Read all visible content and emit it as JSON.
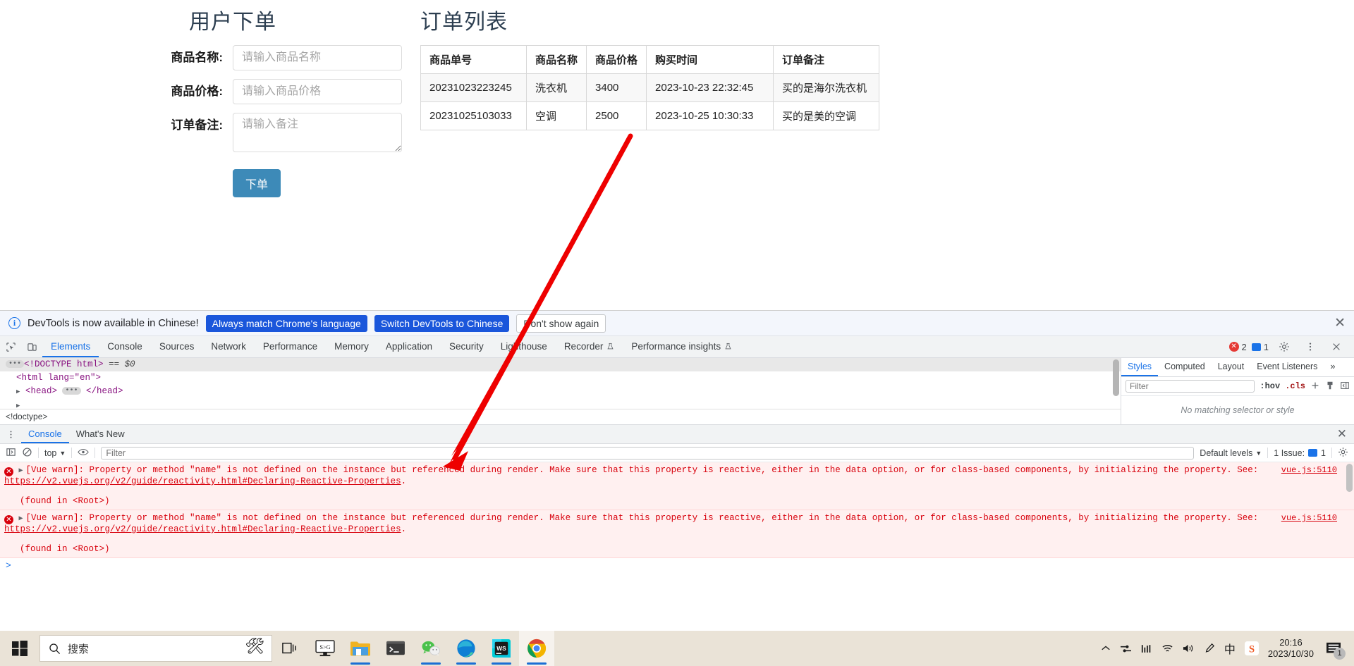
{
  "page": {
    "form": {
      "title": "用户下单",
      "fields": [
        {
          "label": "商品名称:",
          "placeholder": "请输入商品名称",
          "value": "",
          "type": "text"
        },
        {
          "label": "商品价格:",
          "placeholder": "请输入商品价格",
          "value": "",
          "type": "text"
        },
        {
          "label": "订单备注:",
          "placeholder": "请输入备注",
          "value": "",
          "type": "textarea"
        }
      ],
      "submit_label": "下单"
    },
    "order_list": {
      "title": "订单列表",
      "columns": [
        "商品单号",
        "商品名称",
        "商品价格",
        "购买时间",
        "订单备注"
      ],
      "rows": [
        [
          "20231023223245",
          "洗衣机",
          "3400",
          "2023-10-23 22:32:45",
          "买的是海尔洗衣机"
        ],
        [
          "20231025103033",
          "空调",
          "2500",
          "2023-10-25 10:30:33",
          "买的是美的空调"
        ]
      ]
    },
    "annotation": {
      "color": "#ee0000",
      "shape": "arrow"
    }
  },
  "devtools": {
    "banner": {
      "icon": "info-icon",
      "message": "DevTools is now available in Chinese!",
      "primary_button": "Always match Chrome's language",
      "secondary_button": "Switch DevTools to Chinese",
      "dismiss_button": "Don't show again",
      "close_icon": "✕",
      "accent": "#1a56db"
    },
    "tabs": [
      {
        "label": "Elements",
        "active": true
      },
      {
        "label": "Console",
        "active": false
      },
      {
        "label": "Sources",
        "active": false
      },
      {
        "label": "Network",
        "active": false
      },
      {
        "label": "Performance",
        "active": false
      },
      {
        "label": "Memory",
        "active": false
      },
      {
        "label": "Application",
        "active": false
      },
      {
        "label": "Security",
        "active": false
      },
      {
        "label": "Lighthouse",
        "active": false
      },
      {
        "label": "Recorder",
        "active": false,
        "badge": "experiment-flask-icon"
      },
      {
        "label": "Performance insights",
        "active": false,
        "badge": "experiment-flask-icon"
      }
    ],
    "status": {
      "error_count": "2",
      "message_count": "1"
    },
    "dom": {
      "line1_prefix": "<!DOCTYPE html>",
      "line1_suffix": "== $0",
      "line2": "<html lang=\"en\">",
      "line3_open": "<head>",
      "line3_close": "</head>",
      "breadcrumb": "<!doctype>"
    },
    "styles": {
      "tabs": [
        "Styles",
        "Computed",
        "Layout",
        "Event Listeners"
      ],
      "overflow": "»",
      "filter_placeholder": "Filter",
      "hov_label": ":hov",
      "cls_label": ".cls",
      "empty_message": "No matching selector or style"
    },
    "drawer": {
      "tabs": [
        {
          "label": "Console",
          "active": true
        },
        {
          "label": "What's New",
          "active": false
        }
      ],
      "close_icon": "✕",
      "context": "top",
      "filter_placeholder": "Filter",
      "levels": "Default levels",
      "issues_label": "1 Issue:",
      "issues_count": "1",
      "prompt": ">",
      "messages": [
        {
          "level": "error",
          "text": "[Vue warn]: Property or method \"name\" is not defined on the instance but referenced during render. Make sure that this property is reactive, either in the data option, or for class-based components, by initializing the property. See: ",
          "link": "https://v2.vuejs.org/v2/guide/reactivity.html#Declaring-Reactive-Properties",
          "tail": ".",
          "found_in": "(found in <Root>)",
          "source": "vue.js:5110"
        },
        {
          "level": "error",
          "text": "[Vue warn]: Property or method \"name\" is not defined on the instance but referenced during render. Make sure that this property is reactive, either in the data option, or for class-based components, by initializing the property. See: ",
          "link": "https://v2.vuejs.org/v2/guide/reactivity.html#Declaring-Reactive-Properties",
          "tail": ".",
          "found_in": "(found in <Root>)",
          "source": "vue.js:5110"
        }
      ]
    }
  },
  "taskbar": {
    "start_icon": "windows-logo-icon",
    "search_placeholder": "搜索",
    "search_icon": "search-icon",
    "apps": [
      {
        "name": "task-view-icon",
        "running": false
      },
      {
        "name": "snipaste-icon",
        "running": false
      },
      {
        "name": "file-explorer-icon",
        "running": true
      },
      {
        "name": "terminal-icon",
        "running": false
      },
      {
        "name": "wechat-icon",
        "running": true
      },
      {
        "name": "microsoft-edge-icon",
        "running": true
      },
      {
        "name": "webstorm-icon",
        "running": true
      },
      {
        "name": "google-chrome-icon",
        "running": true,
        "active": true
      }
    ],
    "tray": [
      "show-hidden-icons-icon",
      "network-adjust-icon",
      "equalizer-icon",
      "wifi-icon",
      "volume-icon",
      "pen-icon",
      "ime-chinese-icon",
      "sogou-input-icon"
    ],
    "clock_time": "20:16",
    "clock_date": "2023/10/30",
    "notification_count": "1"
  }
}
